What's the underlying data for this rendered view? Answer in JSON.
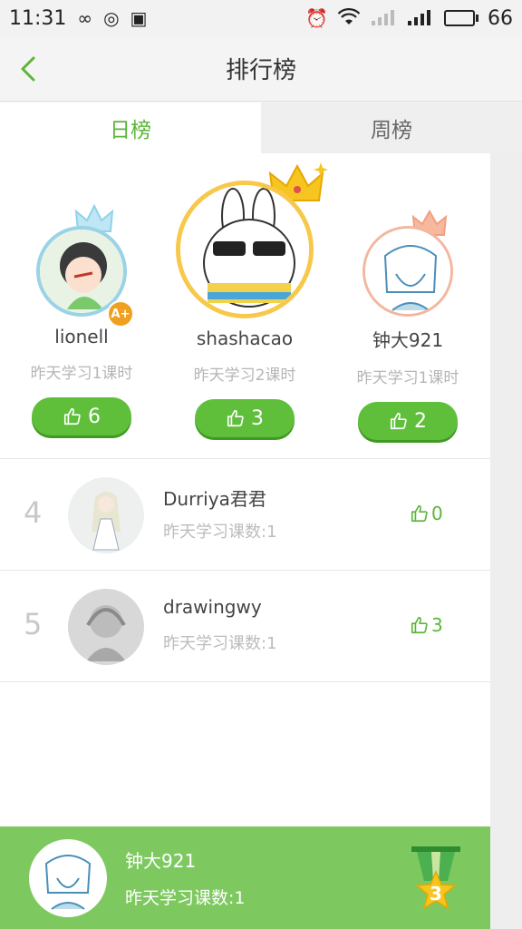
{
  "status_bar": {
    "time": "11:31",
    "battery": "66",
    "signal_label": "4G"
  },
  "header": {
    "title": "排行榜"
  },
  "tabs": [
    {
      "label": "日榜",
      "active": true
    },
    {
      "label": "周榜",
      "active": false
    }
  ],
  "podium": [
    {
      "rank": 2,
      "name": "lionell",
      "sub": "昨天学习1课时",
      "likes": "6",
      "crown_color": "#8fd3ea",
      "badge": "A+"
    },
    {
      "rank": 1,
      "name": "shashacao",
      "sub": "昨天学习2课时",
      "likes": "3",
      "crown_color": "#f7c520"
    },
    {
      "rank": 3,
      "name": "钟大921",
      "sub": "昨天学习1课时",
      "likes": "2",
      "crown_color": "#f2a07f"
    }
  ],
  "list": [
    {
      "rank": "4",
      "name": "Durriya君君",
      "sub": "昨天学习课数:1",
      "likes": "0"
    },
    {
      "rank": "5",
      "name": "drawingwy",
      "sub": "昨天学习课数:1",
      "likes": "3"
    }
  ],
  "me": {
    "name": "钟大921",
    "sub": "昨天学习课数:1",
    "rank": "3"
  },
  "colors": {
    "accent": "#5cb53a",
    "button": "#5fbf3b",
    "bottom_bar": "#7dc960",
    "gold": "#f7c520"
  },
  "icons": [
    "back-arrow-icon",
    "thumbs-up-icon",
    "crown-icon",
    "medal-icon"
  ]
}
